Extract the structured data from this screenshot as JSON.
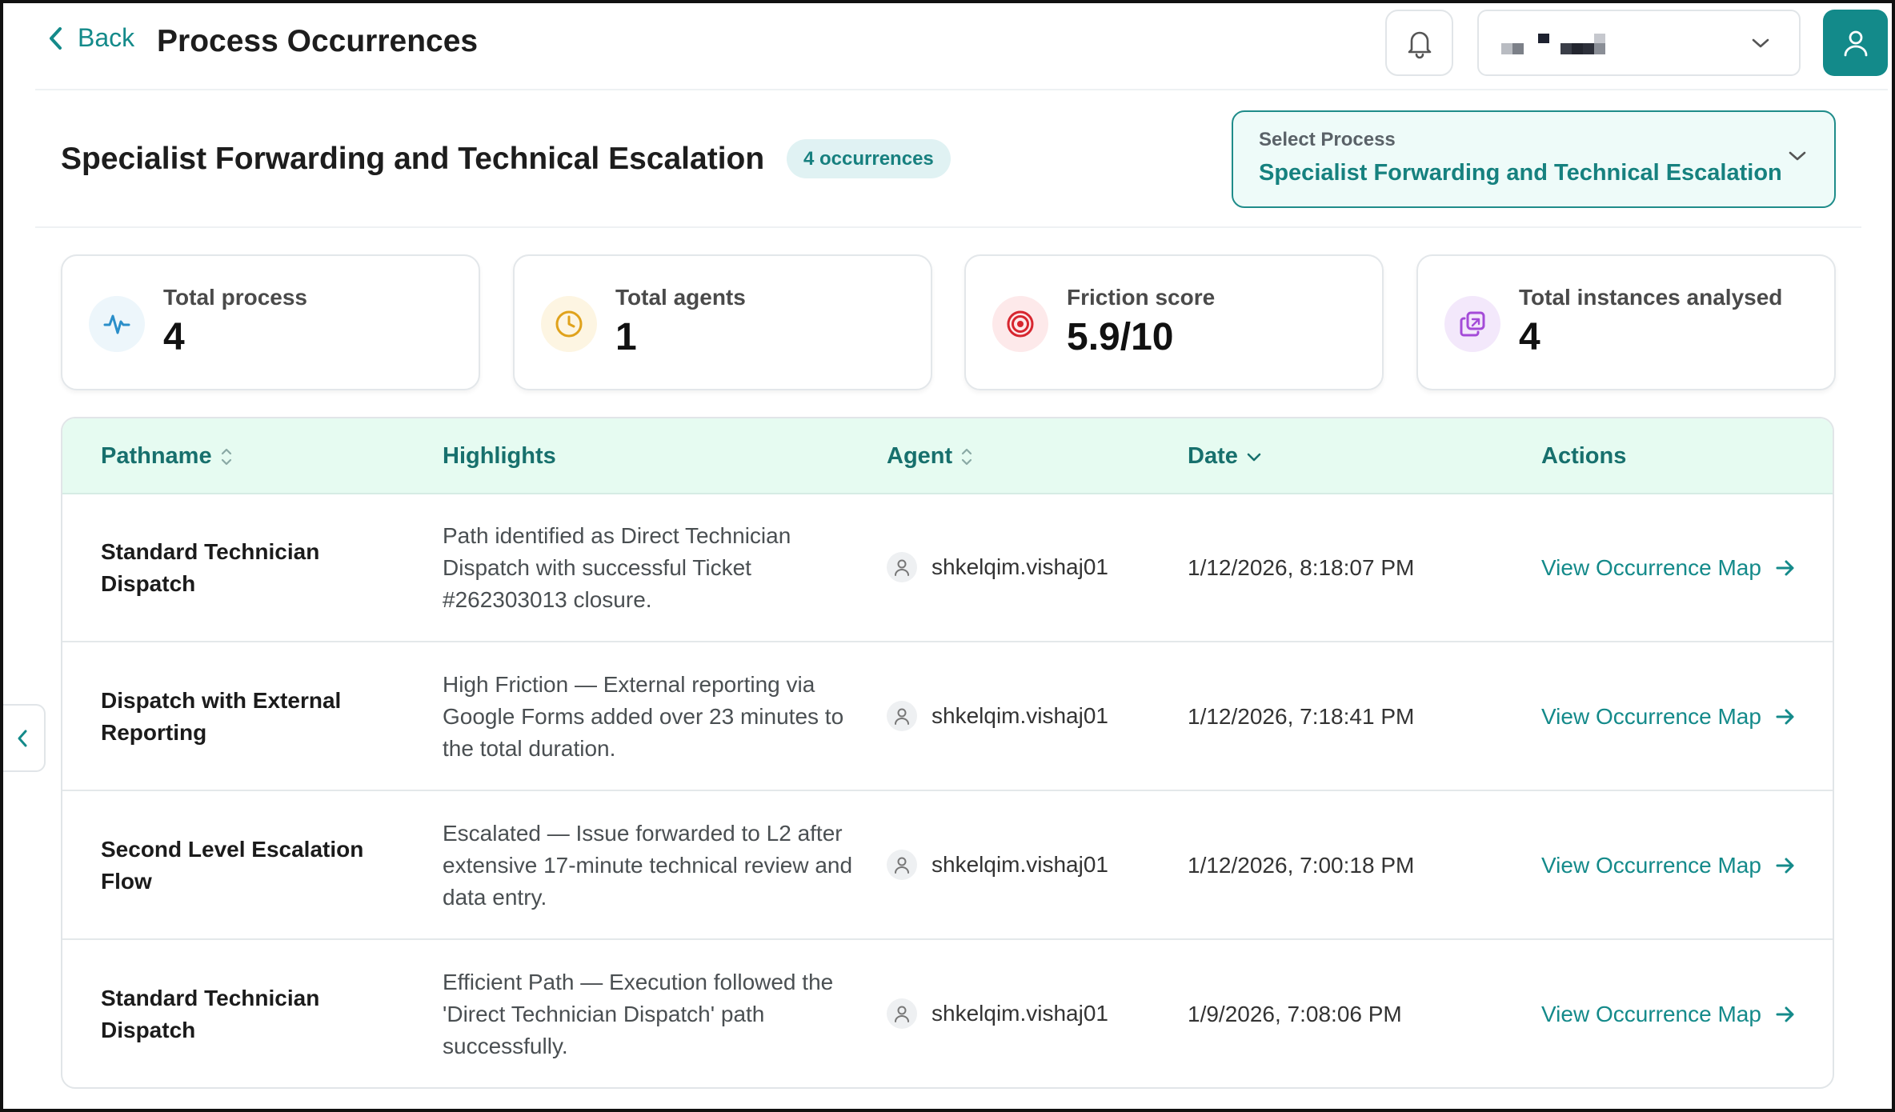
{
  "header": {
    "back_label": "Back",
    "title": "Process Occurrences"
  },
  "process": {
    "title": "Specialist Forwarding and Technical Escalation",
    "occurrences_badge": "4 occurrences",
    "select_label": "Select Process",
    "select_value": "Specialist Forwarding and Technical Escalation"
  },
  "stats": [
    {
      "label": "Total process",
      "value": "4",
      "icon": "activity-icon",
      "color": "#2a8ec9"
    },
    {
      "label": "Total agents",
      "value": "1",
      "icon": "clock-icon",
      "color": "#e0a21b"
    },
    {
      "label": "Friction score",
      "value": "5.9/10",
      "icon": "target-icon",
      "color": "#d7262f"
    },
    {
      "label": "Total instances analysed",
      "value": "4",
      "icon": "copy-icon",
      "color": "#a44bd8"
    }
  ],
  "table": {
    "columns": {
      "pathname": "Pathname",
      "highlights": "Highlights",
      "agent": "Agent",
      "date": "Date",
      "actions": "Actions"
    },
    "rows": [
      {
        "pathname": "Standard Technician Dispatch",
        "highlights": "Path identified as Direct Technician Dispatch with successful Ticket #262303013 closure.",
        "agent": "shkelqim.vishaj01",
        "date": "1/12/2026, 8:18:07 PM",
        "action": "View Occurrence Map"
      },
      {
        "pathname": "Dispatch with External Reporting",
        "highlights": "High Friction — External reporting via Google Forms added over 23 minutes to the total duration.",
        "agent": "shkelqim.vishaj01",
        "date": "1/12/2026, 7:18:41 PM",
        "action": "View Occurrence Map"
      },
      {
        "pathname": "Second Level Escalation Flow",
        "highlights": "Escalated — Issue forwarded to L2 after extensive 17-minute technical review and data entry.",
        "agent": "shkelqim.vishaj01",
        "date": "1/12/2026, 7:00:18 PM",
        "action": "View Occurrence Map"
      },
      {
        "pathname": "Standard Technician Dispatch",
        "highlights": "Efficient Path — Execution followed the 'Direct Technician Dispatch' path successfully.",
        "agent": "shkelqim.vishaj01",
        "date": "1/9/2026, 7:08:06 PM",
        "action": "View Occurrence Map"
      }
    ]
  },
  "colors": {
    "accent": "#148a8a",
    "header_row_bg": "#e6fbf1"
  }
}
